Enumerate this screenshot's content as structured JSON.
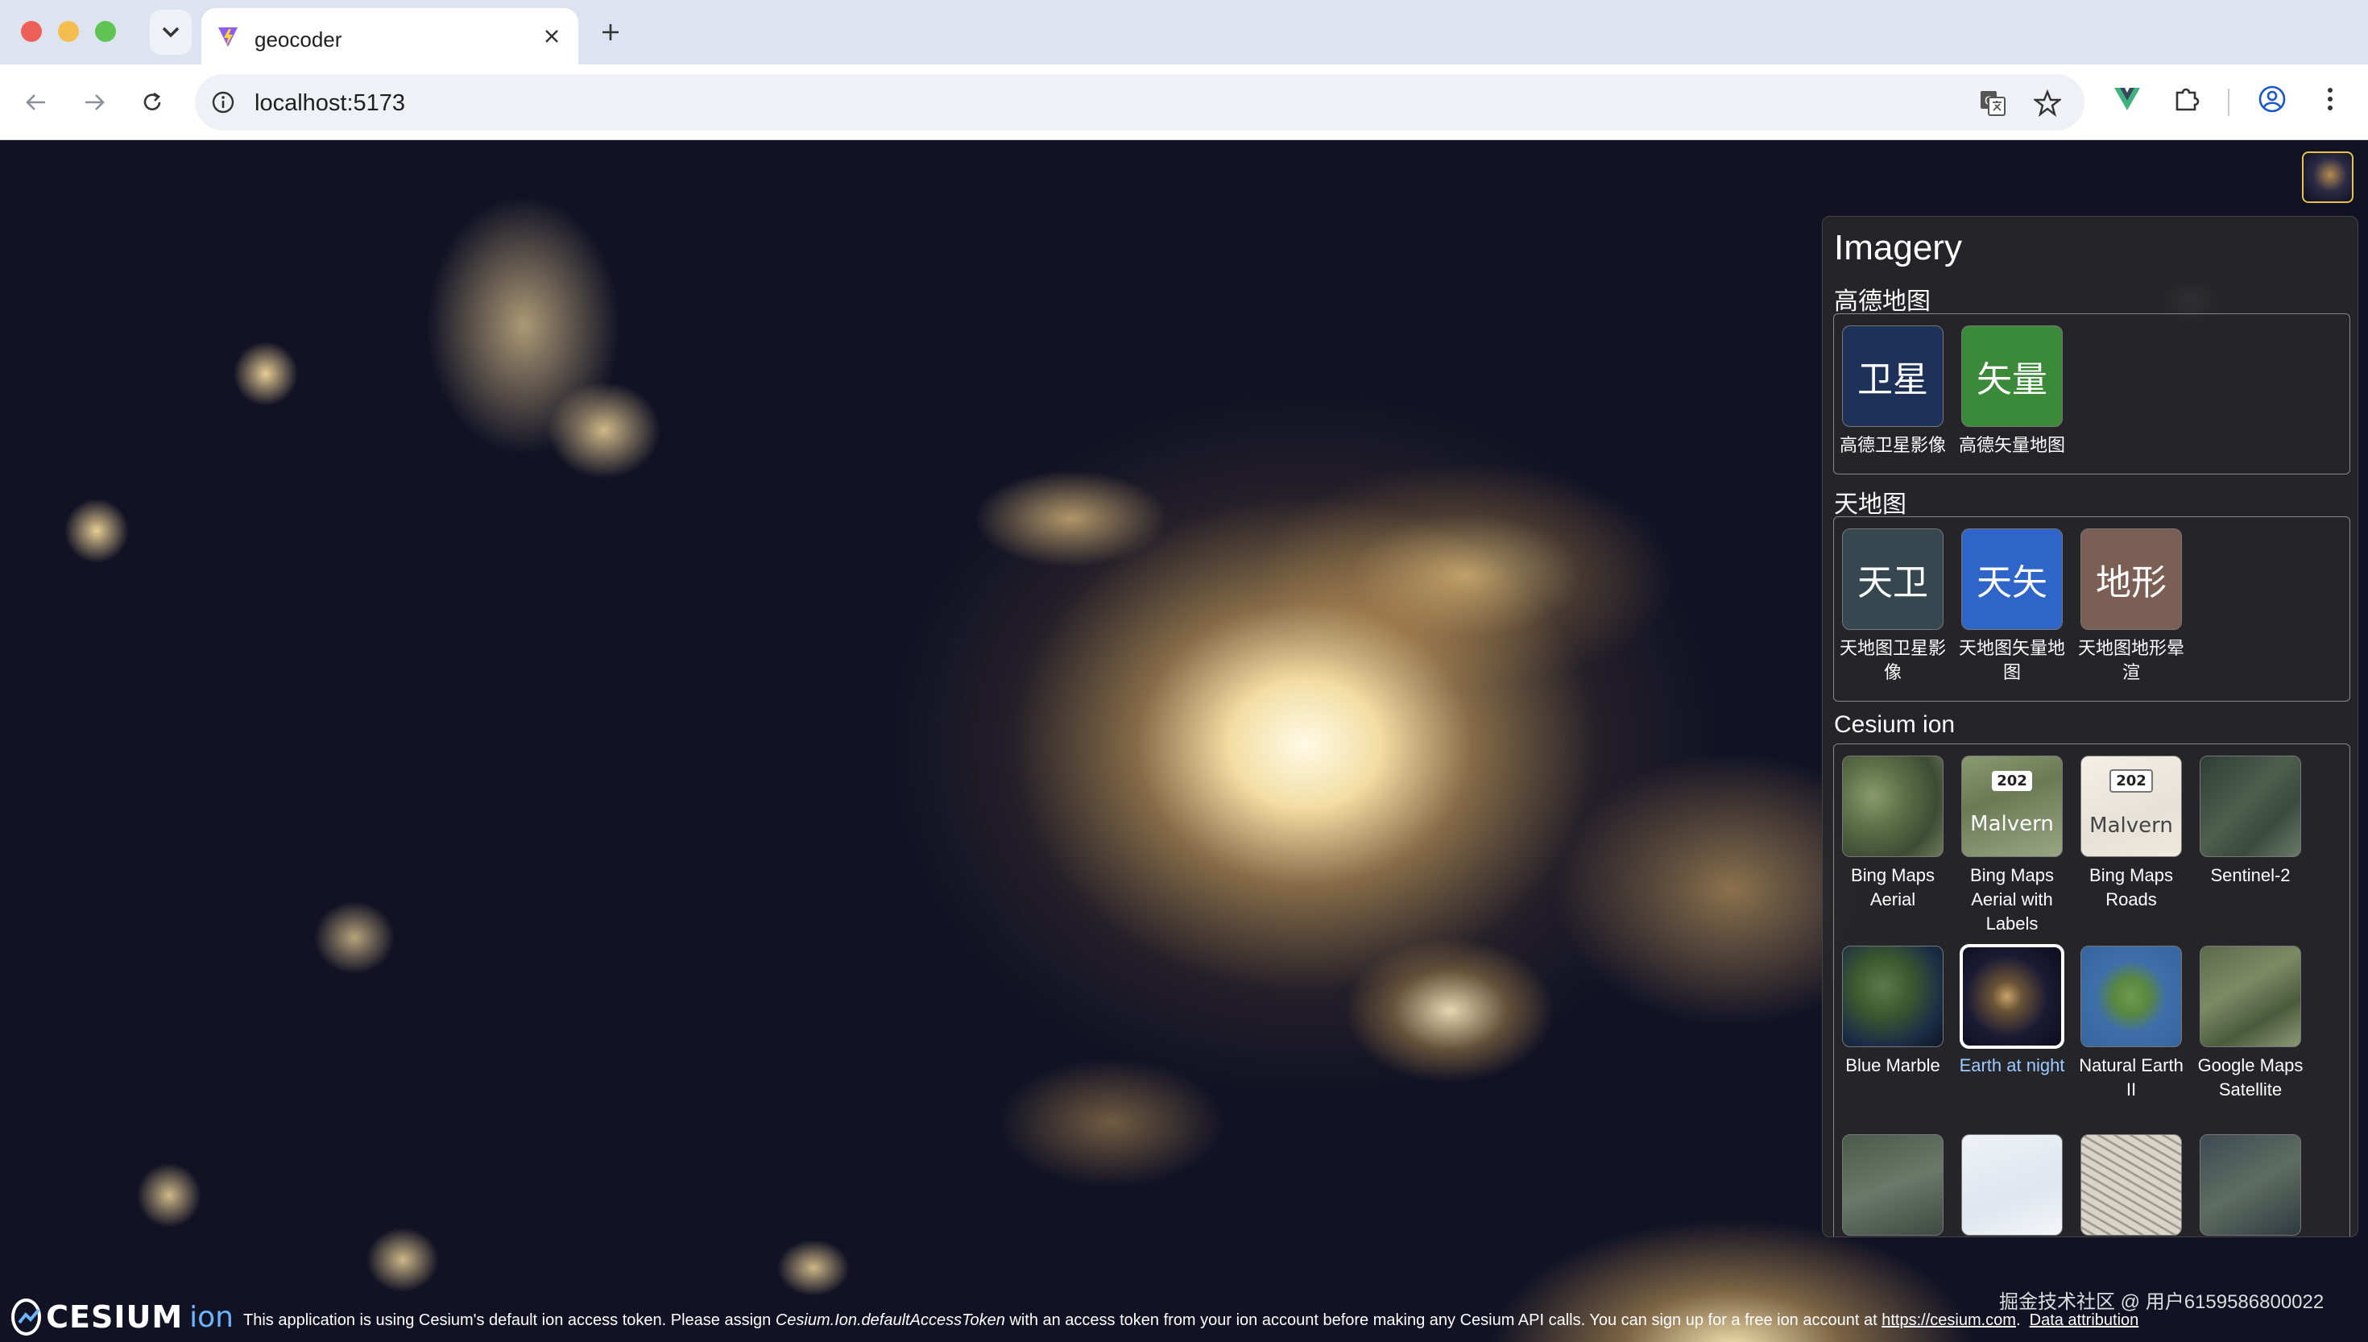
{
  "browser": {
    "tab_title": "geocoder",
    "url": "localhost:5173"
  },
  "panel": {
    "title": "Imagery",
    "categories": [
      {
        "name": "高德地图",
        "items": [
          {
            "thumb_text": "卫星",
            "label": "高德卫星影像",
            "color": "#1e3158"
          },
          {
            "thumb_text": "矢量",
            "label": "高德矢量地图",
            "color": "#3b8a3a"
          }
        ]
      },
      {
        "name": "天地图",
        "items": [
          {
            "thumb_text": "天卫",
            "label": "天地图卫星影像",
            "color": "#36474f"
          },
          {
            "thumb_text": "天矢",
            "label": "天地图矢量地图",
            "color": "#2f64c8"
          },
          {
            "thumb_text": "地形",
            "label": "天地图地形晕渲",
            "color": "#7b5e54"
          }
        ]
      },
      {
        "name": "Cesium ion",
        "items": [
          {
            "label": "Bing Maps Aerial",
            "thumb_label": ""
          },
          {
            "label": "Bing Maps Aerial with Labels",
            "thumb_label": "Malvern",
            "shield": "202"
          },
          {
            "label": "Bing Maps Roads",
            "thumb_label": "Malvern",
            "shield": "202"
          },
          {
            "label": "Sentinel-2",
            "thumb_label": ""
          },
          {
            "label": "Blue Marble",
            "thumb_label": ""
          },
          {
            "label": "Earth at night",
            "thumb_label": "",
            "selected": true
          },
          {
            "label": "Natural Earth II",
            "thumb_label": ""
          },
          {
            "label": "Google Maps Satellite",
            "thumb_label": ""
          }
        ]
      }
    ]
  },
  "credits": {
    "logo_text": "CESIUM",
    "logo_ion": "ion",
    "message_part1": "This application is using Cesium's default ion access token. Please assign ",
    "message_code": "Cesium.Ion.defaultAccessToken",
    "message_part2": " with an access token from your ion account before making any Cesium API calls. You can sign up for a free ion account at ",
    "link_cesium": "https://cesium.com",
    "link_attribution": "Data attribution"
  },
  "watermark": "掘金技术社区 @ 用户6159586800022"
}
